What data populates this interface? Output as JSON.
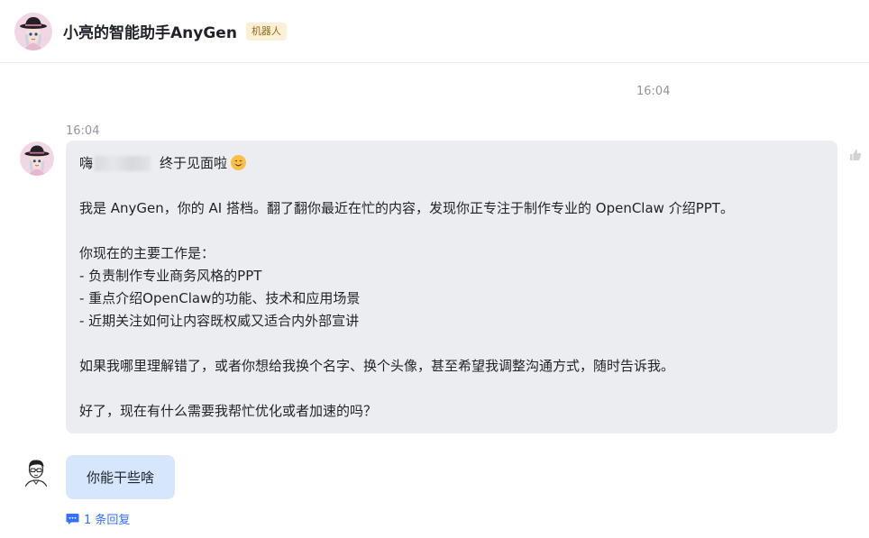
{
  "header": {
    "title": "小亮的智能助手AnyGen",
    "badge": "机器人"
  },
  "timestamps": {
    "center": "16:04",
    "bot_message": "16:04"
  },
  "bot_message": {
    "greeting_prefix": "嗨",
    "greeting_suffix": "终于见面啦",
    "intro": "我是 AnyGen，你的 AI 搭档。翻了翻你最近在忙的内容，发现你正专注于制作专业的 OpenClaw 介绍PPT。",
    "work_heading": "你现在的主要工作是：",
    "work_items": [
      "- 负责制作专业商务风格的PPT",
      "- 重点介绍OpenClaw的功能、技术和应用场景",
      "- 近期关注如何让内容既权威又适合内外部宣讲"
    ],
    "feedback": "如果我哪里理解错了，或者你想给我换个名字、换个头像，甚至希望我调整沟通方式，随时告诉我。",
    "closing": "好了，现在有什么需要我帮忙优化或者加速的吗？"
  },
  "user_message": {
    "text": "你能干些啥"
  },
  "thread": {
    "reply_label": "1 条回复"
  },
  "colors": {
    "bot_bubble": "#ebedf0",
    "user_bubble": "#d6e6fd",
    "link": "#3370ff",
    "badge_bg": "#fbf0d4"
  }
}
